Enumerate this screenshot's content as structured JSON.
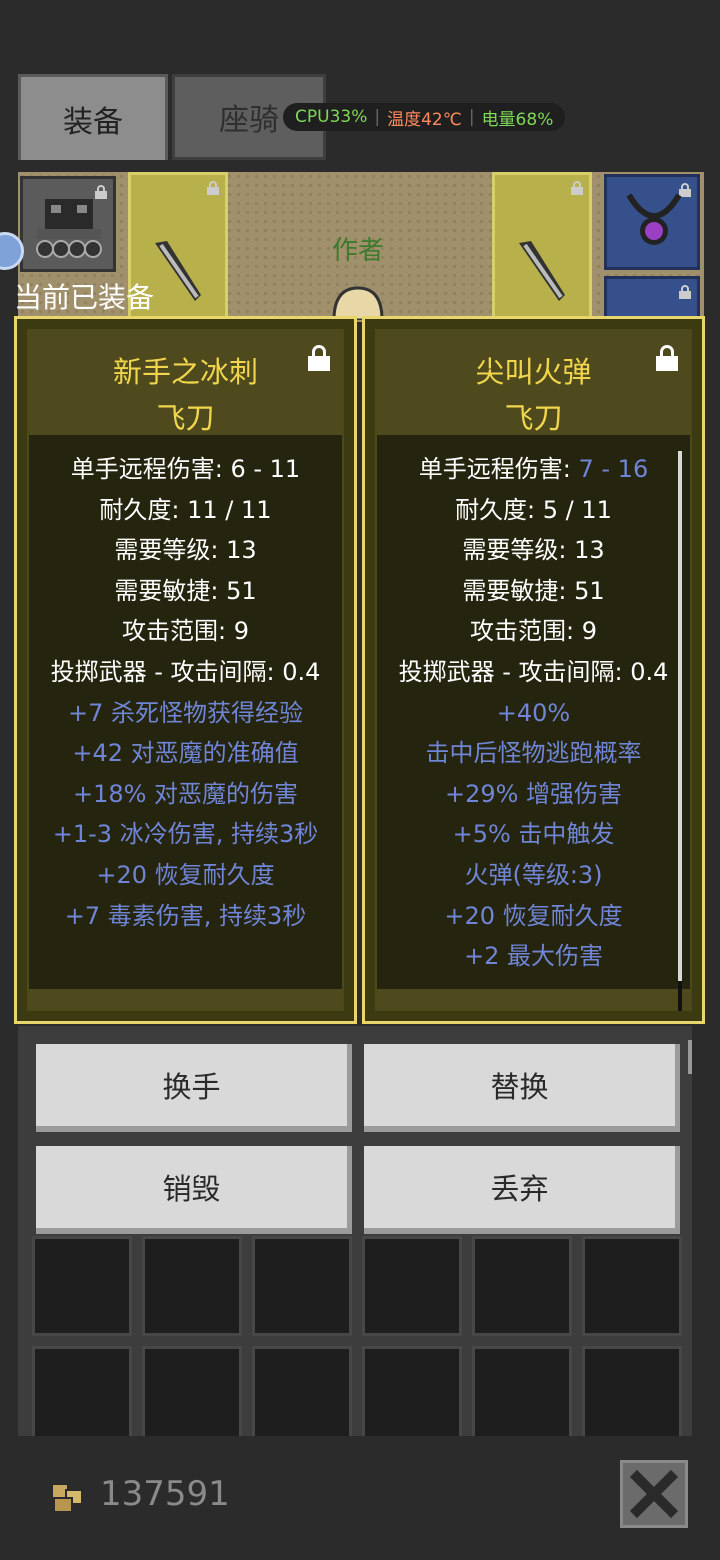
{
  "tabs": {
    "equipment": "装备",
    "mount": "座骑"
  },
  "sysbar": {
    "cpu": "CPU33%",
    "temp": "温度42℃",
    "battery": "电量68%"
  },
  "colors": {
    "cpu": "#7ed957",
    "temp": "#ff8a5c",
    "battery": "#7ed957"
  },
  "scene": {
    "author": "作者",
    "equipped_label": "当前已装备"
  },
  "cards": [
    {
      "name": "新手之冰刺",
      "type": "飞刀",
      "lines": [
        {
          "text": "单手远程伤害: 6 - 11"
        },
        {
          "text": "耐久度: 11 / 11"
        },
        {
          "text": "需要等级: 13"
        },
        {
          "text": "需要敏捷: 51"
        },
        {
          "text": "攻击范围: 9"
        },
        {
          "text": "投掷武器 - 攻击间隔: 0.4"
        },
        {
          "text": "+7 杀死怪物获得经验",
          "blue": true
        },
        {
          "text": "+42 对恶魔的准确值",
          "blue": true
        },
        {
          "text": "+18% 对恶魔的伤害",
          "blue": true
        },
        {
          "text": "+1-3 冰冷伤害, 持续3秒",
          "blue": true
        },
        {
          "text": "+20 恢复耐久度",
          "blue": true
        },
        {
          "text": "+7 毒素伤害, 持续3秒",
          "blue": true
        }
      ]
    },
    {
      "name": "尖叫火弹",
      "type": "飞刀",
      "damage_label": "单手远程伤害: ",
      "damage_value": "7 - 16",
      "lines": [
        {
          "text": "耐久度: 5 / 11"
        },
        {
          "text": "需要等级: 13"
        },
        {
          "text": "需要敏捷: 51"
        },
        {
          "text": "攻击范围: 9"
        },
        {
          "text": "投掷武器 - 攻击间隔: 0.4"
        },
        {
          "text": "+40%",
          "blue": true
        },
        {
          "text": "击中后怪物逃跑概率",
          "blue": true
        },
        {
          "text": "+29% 增强伤害",
          "blue": true
        },
        {
          "text": "+5% 击中触发",
          "blue": true
        },
        {
          "text": "火弹(等级:3)",
          "blue": true
        },
        {
          "text": "+20 恢复耐久度",
          "blue": true
        },
        {
          "text": "+2 最大伤害",
          "blue": true
        }
      ]
    }
  ],
  "actions": {
    "swap_hand": "换手",
    "replace": "替换",
    "destroy": "销毁",
    "discard": "丢弃"
  },
  "footer": {
    "gold": "137591"
  }
}
